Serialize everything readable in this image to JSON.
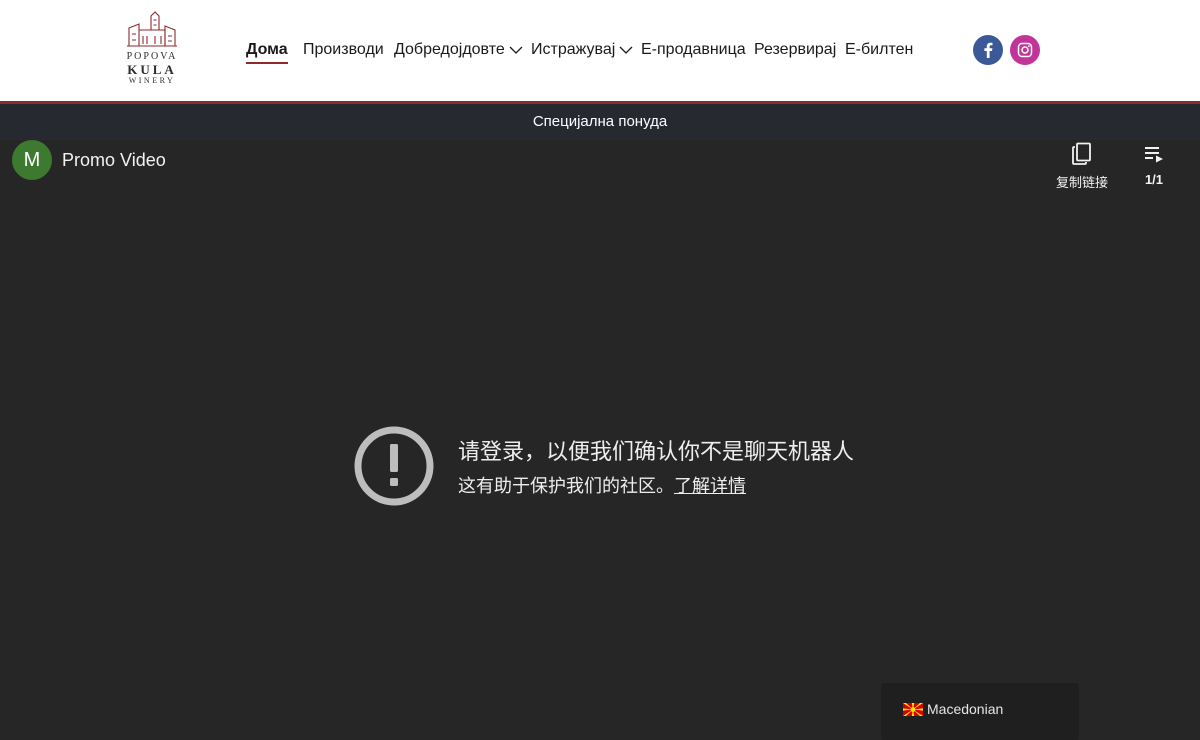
{
  "header": {
    "logo": {
      "line1": "POPOVA",
      "line2": "KULA",
      "line3": "WINERY"
    },
    "nav": [
      {
        "label": "Дома",
        "active": true,
        "dropdown": false
      },
      {
        "label": "Производи",
        "active": false,
        "dropdown": false
      },
      {
        "label": "Добредојдовте",
        "active": false,
        "dropdown": true
      },
      {
        "label": "Истражувај",
        "active": false,
        "dropdown": true
      },
      {
        "label": "Е-продавница",
        "active": false,
        "dropdown": false
      },
      {
        "label": "Резервирај",
        "active": false,
        "dropdown": false
      },
      {
        "label": "Е-билтен",
        "active": false,
        "dropdown": false
      }
    ],
    "social": [
      "facebook-icon",
      "instagram-icon"
    ]
  },
  "promo_bar": {
    "text": "Специјална понуда"
  },
  "player": {
    "avatar_letter": "M",
    "title": "Promo Video",
    "copy_link_label": "复制链接",
    "playlist_count": "1/1",
    "error": {
      "title": "请登录，以便我们确认你不是聊天机器人",
      "message": "这有助于保护我们的社区。",
      "link": "了解详情"
    }
  },
  "language": {
    "label": "Macedonian"
  },
  "colors": {
    "accent": "#8c2a2e",
    "facebook": "#3b5998",
    "instagram": "#c1359b",
    "avatar": "#3d7a2f",
    "player_bg": "#262626",
    "promo_bg": "#262a30"
  }
}
